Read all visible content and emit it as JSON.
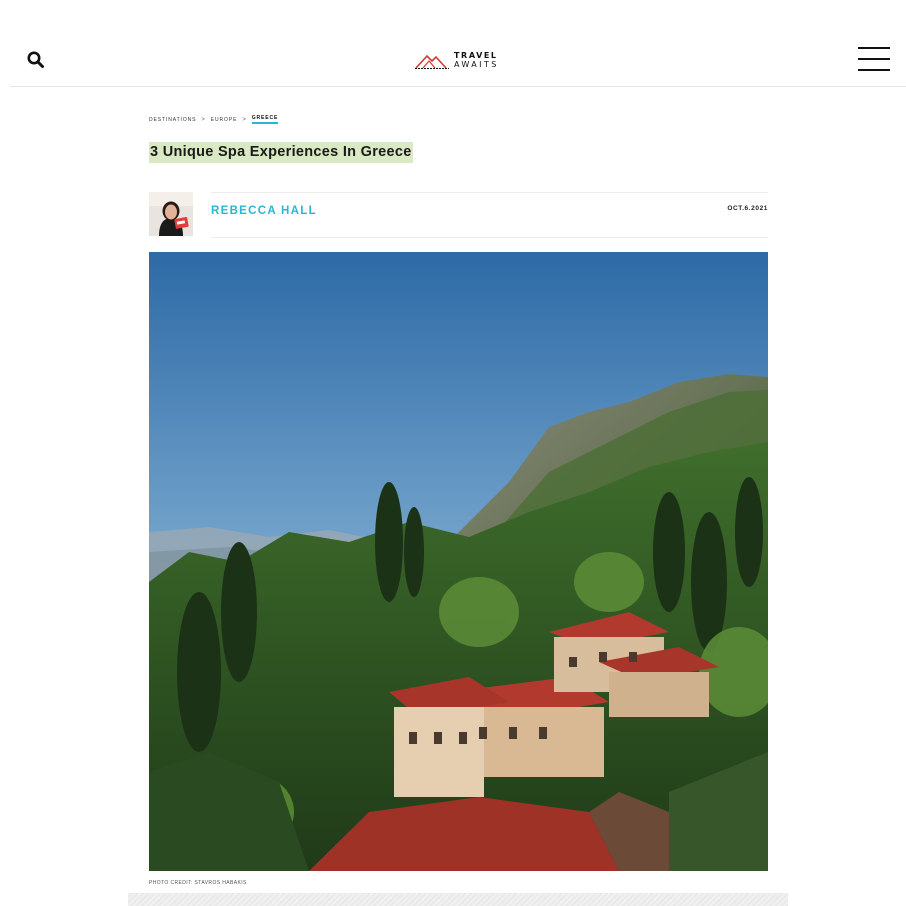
{
  "header": {
    "logo_line1": "TRAVEL",
    "logo_line2": "AWAITS",
    "search_icon": "search-icon",
    "menu_icon": "hamburger-menu-icon"
  },
  "breadcrumb": {
    "items": [
      "DESTINATIONS",
      "EUROPE",
      "GREECE"
    ],
    "separator": ">"
  },
  "article": {
    "title": "3 Unique Spa Experiences In Greece",
    "author": "REBECCA HALL",
    "date": "OCT.6.2021",
    "photo_credit": "PHOTO CREDIT: STAVROS HABAKIS"
  },
  "colors": {
    "accent": "#27b7d4",
    "title_highlight": "#d9e9c3",
    "logo_red": "#d23a2f"
  }
}
